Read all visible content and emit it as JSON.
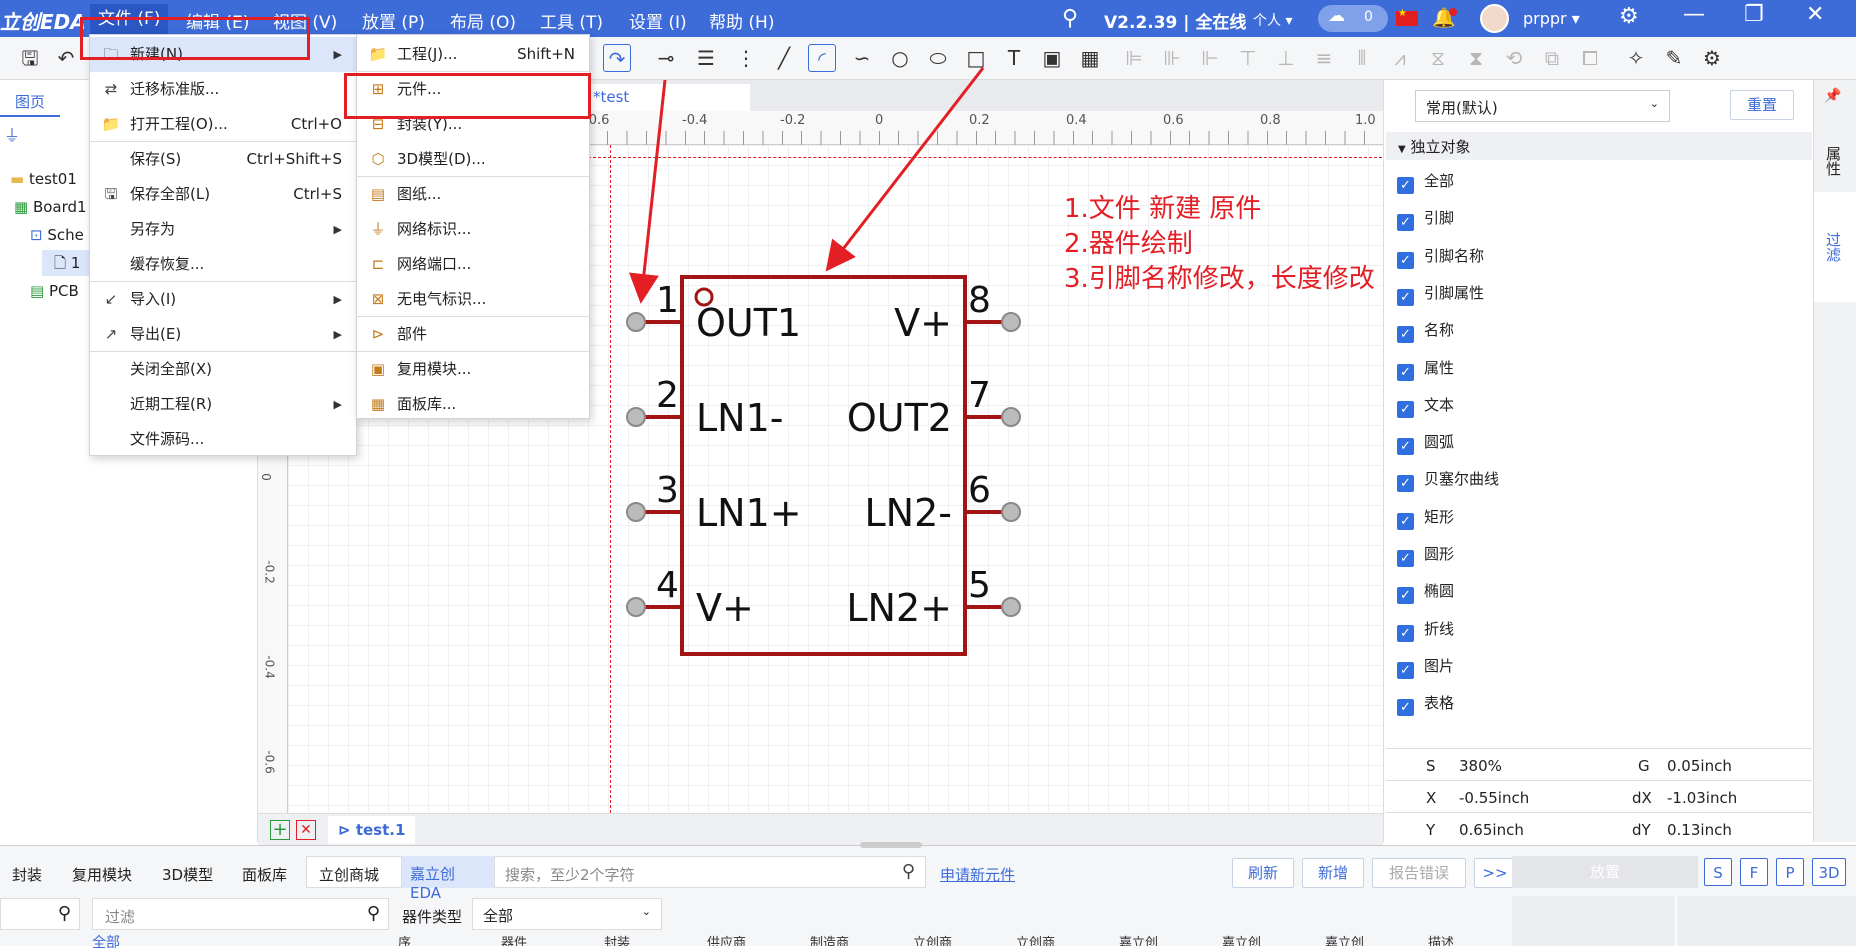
{
  "app": {
    "logo": "立创EDA",
    "version": "V2.2.39 | 全在线",
    "personal": "个人",
    "cloud_count": "0",
    "username": "prppr"
  },
  "menubar": [
    "文件 (F)",
    "编辑 (E)",
    "视图 (V)",
    "放置 (P)",
    "布局 (O)",
    "工具 (T)",
    "设置 (I)",
    "帮助 (H)"
  ],
  "left_panel": {
    "tab": "图页",
    "tree": [
      "test01",
      "Board1",
      "Sche",
      "1",
      "PCB"
    ]
  },
  "file_menu": [
    {
      "icon": "new-icon",
      "label": "新建(N)",
      "shortcut": "",
      "submenu": true
    },
    {
      "icon": "migrate-icon",
      "label": "迁移标准版...",
      "shortcut": "",
      "submenu": false
    },
    {
      "icon": "folder-icon",
      "label": "打开工程(O)...",
      "shortcut": "Ctrl+O",
      "submenu": false
    },
    {
      "icon": "",
      "label": "保存(S)",
      "shortcut": "Ctrl+Shift+S",
      "submenu": false
    },
    {
      "icon": "save-all-icon",
      "label": "保存全部(L)",
      "shortcut": "Ctrl+S",
      "submenu": false
    },
    {
      "icon": "",
      "label": "另存为",
      "shortcut": "",
      "submenu": true
    },
    {
      "icon": "",
      "label": "缓存恢复...",
      "shortcut": "",
      "submenu": false
    },
    {
      "icon": "import-icon",
      "label": "导入(I)",
      "shortcut": "",
      "submenu": true
    },
    {
      "icon": "export-icon",
      "label": "导出(E)",
      "shortcut": "",
      "submenu": true
    },
    {
      "icon": "",
      "label": "关闭全部(X)",
      "shortcut": "",
      "submenu": false
    },
    {
      "icon": "",
      "label": "近期工程(R)",
      "shortcut": "",
      "submenu": true
    },
    {
      "icon": "",
      "label": "文件源码...",
      "shortcut": "",
      "submenu": false
    }
  ],
  "new_submenu": [
    {
      "icon": "folder-icon",
      "label": "工程(J)...",
      "shortcut": "Shift+N"
    },
    {
      "icon": "component-icon",
      "label": "元件...",
      "shortcut": ""
    },
    {
      "icon": "footprint-icon",
      "label": "封装(Y)...",
      "shortcut": ""
    },
    {
      "icon": "3d-model-icon",
      "label": "3D模型(D)...",
      "shortcut": ""
    },
    {
      "icon": "drawing-icon",
      "label": "图纸...",
      "shortcut": ""
    },
    {
      "icon": "net-label-icon",
      "label": "网络标识...",
      "shortcut": ""
    },
    {
      "icon": "net-port-icon",
      "label": "网络端口...",
      "shortcut": ""
    },
    {
      "icon": "no-connect-icon",
      "label": "无电气标识...",
      "shortcut": ""
    },
    {
      "icon": "part-icon",
      "label": "部件",
      "shortcut": ""
    },
    {
      "icon": "reuse-module-icon",
      "label": "复用模块...",
      "shortcut": ""
    },
    {
      "icon": "panel-lib-icon",
      "label": "面板库...",
      "shortcut": ""
    }
  ],
  "document": {
    "tab": "*test",
    "ruler_top": [
      "-0.6",
      "-0.4",
      "-0.2",
      "0",
      "0.2",
      "0.4",
      "0.6",
      "0.8",
      "1.0"
    ],
    "ruler_left": [
      "0",
      "-0.2",
      "-0.4",
      "-0.6"
    ],
    "bottom_tab": "test.1"
  },
  "component": {
    "pins_left": [
      {
        "num": "1",
        "name": "OUT1"
      },
      {
        "num": "2",
        "name": "LN1-"
      },
      {
        "num": "3",
        "name": "LN1+"
      },
      {
        "num": "4",
        "name": "V+"
      }
    ],
    "pins_right": [
      {
        "num": "8",
        "name": "V+"
      },
      {
        "num": "7",
        "name": "OUT2"
      },
      {
        "num": "6",
        "name": "LN2-"
      },
      {
        "num": "5",
        "name": "LN2+"
      }
    ],
    "color": "#a31515"
  },
  "annotations": [
    "1.文件 新建 原件",
    "2.器件绘制",
    "3.引脚名称修改，长度修改"
  ],
  "right_panel": {
    "dropdown": "常用(默认)",
    "reset": "重置",
    "section": "独立对象",
    "filters": [
      "全部",
      "引脚",
      "引脚名称",
      "引脚属性",
      "名称",
      "属性",
      "文本",
      "圆弧",
      "贝塞尔曲线",
      "矩形",
      "圆形",
      "椭圆",
      "折线",
      "图片",
      "表格"
    ],
    "status": {
      "s_label": "S",
      "s_val": "380%",
      "g_label": "G",
      "g_val": "0.05inch",
      "x_label": "X",
      "x_val": "-0.55inch",
      "dx_label": "dX",
      "dx_val": "-1.03inch",
      "y_label": "Y",
      "y_val": "0.65inch",
      "dy_label": "dY",
      "dy_val": "0.13inch"
    },
    "side_tabs": [
      "属性",
      "过滤"
    ]
  },
  "bottom_panel": {
    "tabs": [
      "封装",
      "复用模块",
      "3D模型",
      "面板库",
      "立创商城",
      "嘉立创EDA"
    ],
    "search_placeholder": "搜索，至少2个字符",
    "apply_link": "申请新元件",
    "buttons": [
      "刷新",
      "新增",
      "报告错误",
      ">>"
    ],
    "filter_placeholder": "过滤",
    "type_label": "器件类型",
    "type_value": "全部",
    "place_btn": "放置",
    "mode_btns": [
      "S",
      "F",
      "P",
      "3D"
    ],
    "columns": [
      "序",
      "器件",
      "封装",
      "供应商",
      "制造商",
      "立创商",
      "立创商",
      "嘉立创",
      "嘉立创",
      "嘉立创",
      "描述"
    ],
    "tree_first": "全部"
  }
}
